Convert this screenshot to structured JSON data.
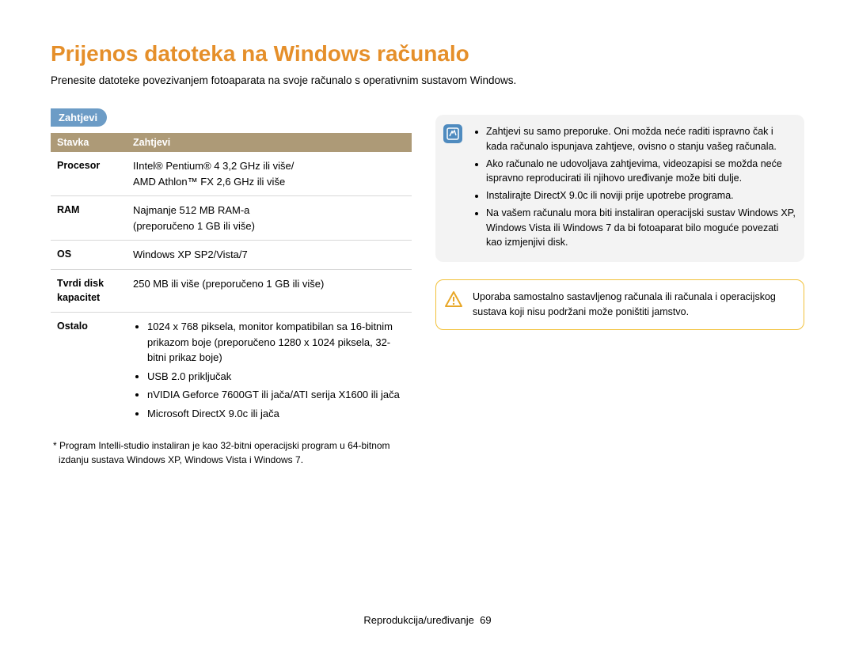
{
  "title": "Prijenos datoteka na Windows računalo",
  "intro": "Prenesite datoteke povezivanjem fotoaparata na svoje računalo s operativnim sustavom Windows.",
  "section_heading": "Zahtjevi",
  "table": {
    "header": {
      "col1": "Stavka",
      "col2": "Zahtjevi"
    },
    "rows": {
      "procesor": {
        "label": "Procesor",
        "line1": "IIntel® Pentium® 4 3,2 GHz ili više/",
        "line2": "AMD Athlon™ FX 2,6 GHz ili više"
      },
      "ram": {
        "label": "RAM",
        "line1": "Najmanje 512 MB RAM-a",
        "line2": "(preporučeno 1 GB ili više)"
      },
      "os": {
        "label": "OS",
        "value": "Windows XP SP2/Vista/7"
      },
      "hdd": {
        "label1": "Tvrdi disk",
        "label2": "kapacitet",
        "value": "250 MB ili više (preporučeno 1 GB ili više)"
      },
      "ostalo": {
        "label": "Ostalo",
        "items": [
          "1024 x 768 piksela, monitor kompatibilan sa 16-bitnim prikazom boje (preporučeno 1280 x 1024 piksela, 32-bitni prikaz boje)",
          "USB 2.0 priključak",
          "nVIDIA Geforce 7600GT ili jača/ATI serija X1600 ili jača",
          "Microsoft DirectX 9.0c ili jača"
        ]
      }
    }
  },
  "footnote": "* Program Intelli-studio instaliran je kao 32-bitni operacijski program u 64-bitnom izdanju sustava Windows XP, Windows Vista i Windows 7.",
  "info_callout": {
    "items": [
      "Zahtjevi su samo preporuke. Oni možda neće raditi ispravno čak i kada računalo ispunjava zahtjeve, ovisno o stanju vašeg računala.",
      "Ako računalo ne udovoljava zahtjevima, videozapisi se možda neće ispravno reproducirati ili njihovo uređivanje može biti dulje.",
      "Instalirajte DirectX 9.0c ili noviji prije upotrebe programa.",
      "Na vašem računalu mora biti instaliran operacijski sustav Windows XP, Windows Vista ili Windows 7 da bi fotoaparat bilo moguće povezati kao izmjenjivi disk."
    ]
  },
  "warn_callout": {
    "text": "Uporaba samostalno sastavljenog računala ili računala i operacijskog sustava koji nisu podržani može poništiti jamstvo."
  },
  "footer": {
    "label": "Reprodukcija/uređivanje",
    "page": "69"
  }
}
